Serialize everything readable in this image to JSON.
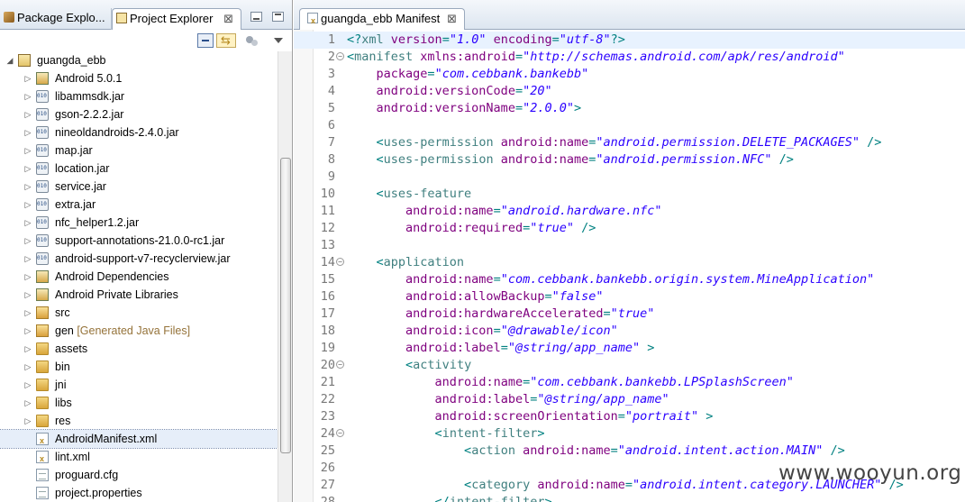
{
  "left_panel": {
    "tabs": [
      {
        "label": "Package Explo..."
      },
      {
        "label": "Project Explorer",
        "close": "⊠"
      }
    ],
    "tree": [
      {
        "label": "guangda_ebb",
        "indent": 0,
        "icon": "project-icon",
        "expand": "◢"
      },
      {
        "label": "Android 5.0.1",
        "indent": 1,
        "icon": "library-icon",
        "expand": "▷"
      },
      {
        "label": "libammsdk.jar",
        "indent": 1,
        "icon": "jar-icon",
        "expand": "▷"
      },
      {
        "label": "gson-2.2.2.jar",
        "indent": 1,
        "icon": "jar-icon",
        "expand": "▷"
      },
      {
        "label": "nineoldandroids-2.4.0.jar",
        "indent": 1,
        "icon": "jar-icon",
        "expand": "▷"
      },
      {
        "label": "map.jar",
        "indent": 1,
        "icon": "jar-icon",
        "expand": "▷"
      },
      {
        "label": "location.jar",
        "indent": 1,
        "icon": "jar-icon",
        "expand": "▷"
      },
      {
        "label": "service.jar",
        "indent": 1,
        "icon": "jar-icon",
        "expand": "▷"
      },
      {
        "label": "extra.jar",
        "indent": 1,
        "icon": "jar-icon",
        "expand": "▷"
      },
      {
        "label": "nfc_helper1.2.jar",
        "indent": 1,
        "icon": "jar-icon",
        "expand": "▷"
      },
      {
        "label": "support-annotations-21.0.0-rc1.jar",
        "indent": 1,
        "icon": "jar-icon",
        "expand": "▷"
      },
      {
        "label": "android-support-v7-recyclerview.jar",
        "indent": 1,
        "icon": "jar-icon",
        "expand": "▷"
      },
      {
        "label": "Android Dependencies",
        "indent": 1,
        "icon": "library-icon",
        "expand": "▷"
      },
      {
        "label": "Android Private Libraries",
        "indent": 1,
        "icon": "library-icon",
        "expand": "▷"
      },
      {
        "label": "src",
        "indent": 1,
        "icon": "source-folder-icon",
        "expand": "▷"
      },
      {
        "label": "gen",
        "decoration": "[Generated Java Files]",
        "indent": 1,
        "icon": "source-folder-icon",
        "expand": "▷"
      },
      {
        "label": "assets",
        "indent": 1,
        "icon": "folder-icon",
        "expand": "▷"
      },
      {
        "label": "bin",
        "indent": 1,
        "icon": "folder-icon",
        "expand": "▷"
      },
      {
        "label": "jni",
        "indent": 1,
        "icon": "folder-icon",
        "expand": "▷"
      },
      {
        "label": "libs",
        "indent": 1,
        "icon": "folder-icon",
        "expand": "▷"
      },
      {
        "label": "res",
        "indent": 1,
        "icon": "folder-icon",
        "expand": "▷"
      },
      {
        "label": "AndroidManifest.xml",
        "indent": 1,
        "icon": "xml-file-icon",
        "expand": "",
        "selected": true
      },
      {
        "label": "lint.xml",
        "indent": 1,
        "icon": "xml-file-icon",
        "expand": ""
      },
      {
        "label": "proguard.cfg",
        "indent": 1,
        "icon": "file-icon",
        "expand": ""
      },
      {
        "label": "project.properties",
        "indent": 1,
        "icon": "file-icon",
        "expand": ""
      }
    ]
  },
  "editor": {
    "tab_label": "guangda_ebb Manifest",
    "tab_close": "⊠",
    "fold_marker": "⊖",
    "lines": [
      {
        "n": "1",
        "fold": false,
        "current": true,
        "indent": "",
        "parts": [
          [
            "b",
            "<?"
          ],
          [
            "t",
            "xml"
          ],
          [
            "a",
            " version"
          ],
          [
            "b",
            "="
          ],
          [
            "v",
            "\"1.0\""
          ],
          [
            "a",
            " encoding"
          ],
          [
            "b",
            "="
          ],
          [
            "v",
            "\"utf-8\""
          ],
          [
            "b",
            "?>"
          ]
        ]
      },
      {
        "n": "2",
        "fold": true,
        "indent": "",
        "parts": [
          [
            "b",
            "<"
          ],
          [
            "t",
            "manifest"
          ],
          [
            "a",
            " xmlns:android"
          ],
          [
            "b",
            "="
          ],
          [
            "v",
            "\"http://schemas.android.com/apk/res/android\""
          ]
        ]
      },
      {
        "n": "3",
        "fold": false,
        "indent": "    ",
        "parts": [
          [
            "a",
            "package"
          ],
          [
            "b",
            "="
          ],
          [
            "v",
            "\"com.cebbank.bankebb\""
          ]
        ]
      },
      {
        "n": "4",
        "fold": false,
        "indent": "    ",
        "parts": [
          [
            "a",
            "android:versionCode"
          ],
          [
            "b",
            "="
          ],
          [
            "v",
            "\"20\""
          ]
        ]
      },
      {
        "n": "5",
        "fold": false,
        "indent": "    ",
        "parts": [
          [
            "a",
            "android:versionName"
          ],
          [
            "b",
            "="
          ],
          [
            "v",
            "\"2.0.0\""
          ],
          [
            "b",
            ">"
          ]
        ]
      },
      {
        "n": "6",
        "fold": false,
        "indent": "",
        "parts": []
      },
      {
        "n": "7",
        "fold": false,
        "indent": "    ",
        "parts": [
          [
            "b",
            "<"
          ],
          [
            "t",
            "uses-permission"
          ],
          [
            "a",
            " android:name"
          ],
          [
            "b",
            "="
          ],
          [
            "v",
            "\"android.permission.DELETE_PACKAGES\""
          ],
          [
            "b",
            " />"
          ]
        ]
      },
      {
        "n": "8",
        "fold": false,
        "indent": "    ",
        "parts": [
          [
            "b",
            "<"
          ],
          [
            "t",
            "uses-permission"
          ],
          [
            "a",
            " android:name"
          ],
          [
            "b",
            "="
          ],
          [
            "v",
            "\"android.permission.NFC\""
          ],
          [
            "b",
            " />"
          ]
        ]
      },
      {
        "n": "9",
        "fold": false,
        "indent": "",
        "parts": []
      },
      {
        "n": "10",
        "fold": false,
        "indent": "    ",
        "parts": [
          [
            "b",
            "<"
          ],
          [
            "t",
            "uses-feature"
          ]
        ]
      },
      {
        "n": "11",
        "fold": false,
        "indent": "        ",
        "parts": [
          [
            "a",
            "android:name"
          ],
          [
            "b",
            "="
          ],
          [
            "v",
            "\"android.hardware.nfc\""
          ]
        ]
      },
      {
        "n": "12",
        "fold": false,
        "indent": "        ",
        "parts": [
          [
            "a",
            "android:required"
          ],
          [
            "b",
            "="
          ],
          [
            "v",
            "\"true\""
          ],
          [
            "b",
            " />"
          ]
        ]
      },
      {
        "n": "13",
        "fold": false,
        "indent": "",
        "parts": []
      },
      {
        "n": "14",
        "fold": true,
        "indent": "    ",
        "parts": [
          [
            "b",
            "<"
          ],
          [
            "t",
            "application"
          ]
        ]
      },
      {
        "n": "15",
        "fold": false,
        "indent": "        ",
        "parts": [
          [
            "a",
            "android:name"
          ],
          [
            "b",
            "="
          ],
          [
            "v",
            "\"com.cebbank.bankebb.origin.system.MineApplication\""
          ]
        ]
      },
      {
        "n": "16",
        "fold": false,
        "indent": "        ",
        "parts": [
          [
            "a",
            "android:allowBackup"
          ],
          [
            "b",
            "="
          ],
          [
            "v",
            "\"false\""
          ]
        ]
      },
      {
        "n": "17",
        "fold": false,
        "indent": "        ",
        "parts": [
          [
            "a",
            "android:hardwareAccelerated"
          ],
          [
            "b",
            "="
          ],
          [
            "v",
            "\"true\""
          ]
        ]
      },
      {
        "n": "18",
        "fold": false,
        "indent": "        ",
        "parts": [
          [
            "a",
            "android:icon"
          ],
          [
            "b",
            "="
          ],
          [
            "v",
            "\"@drawable/icon\""
          ]
        ]
      },
      {
        "n": "19",
        "fold": false,
        "indent": "        ",
        "parts": [
          [
            "a",
            "android:label"
          ],
          [
            "b",
            "="
          ],
          [
            "v",
            "\"@string/app_name\""
          ],
          [
            "b",
            " >"
          ]
        ]
      },
      {
        "n": "20",
        "fold": true,
        "indent": "        ",
        "parts": [
          [
            "b",
            "<"
          ],
          [
            "t",
            "activity"
          ]
        ]
      },
      {
        "n": "21",
        "fold": false,
        "indent": "            ",
        "parts": [
          [
            "a",
            "android:name"
          ],
          [
            "b",
            "="
          ],
          [
            "v",
            "\"com.cebbank.bankebb.LPSplashScreen\""
          ]
        ]
      },
      {
        "n": "22",
        "fold": false,
        "indent": "            ",
        "parts": [
          [
            "a",
            "android:label"
          ],
          [
            "b",
            "="
          ],
          [
            "v",
            "\"@string/app_name\""
          ]
        ]
      },
      {
        "n": "23",
        "fold": false,
        "indent": "            ",
        "parts": [
          [
            "a",
            "android:screenOrientation"
          ],
          [
            "b",
            "="
          ],
          [
            "v",
            "\"portrait\""
          ],
          [
            "b",
            " >"
          ]
        ]
      },
      {
        "n": "24",
        "fold": true,
        "indent": "            ",
        "parts": [
          [
            "b",
            "<"
          ],
          [
            "t",
            "intent-filter"
          ],
          [
            "b",
            ">"
          ]
        ]
      },
      {
        "n": "25",
        "fold": false,
        "indent": "                ",
        "parts": [
          [
            "b",
            "<"
          ],
          [
            "t",
            "action"
          ],
          [
            "a",
            " android:name"
          ],
          [
            "b",
            "="
          ],
          [
            "v",
            "\"android.intent.action.MAIN\""
          ],
          [
            "b",
            " />"
          ]
        ]
      },
      {
        "n": "26",
        "fold": false,
        "indent": "",
        "parts": []
      },
      {
        "n": "27",
        "fold": false,
        "indent": "                ",
        "parts": [
          [
            "b",
            "<"
          ],
          [
            "t",
            "category"
          ],
          [
            "a",
            " android:name"
          ],
          [
            "b",
            "="
          ],
          [
            "v",
            "\"android.intent.category.LAUNCHER\""
          ],
          [
            "b",
            " />"
          ]
        ]
      },
      {
        "n": "28",
        "fold": false,
        "indent": "            ",
        "parts": [
          [
            "b",
            "</"
          ],
          [
            "t",
            "intent-filter"
          ],
          [
            "b",
            ">"
          ]
        ]
      }
    ]
  },
  "watermark": "www.wooyun.org",
  "colors": {
    "bracket": "#008080",
    "tag": "#3f7f7f",
    "attribute": "#7f007f",
    "value": "#2a00ff",
    "selection": "#e6eef9",
    "current_line": "#e8f2fe"
  }
}
